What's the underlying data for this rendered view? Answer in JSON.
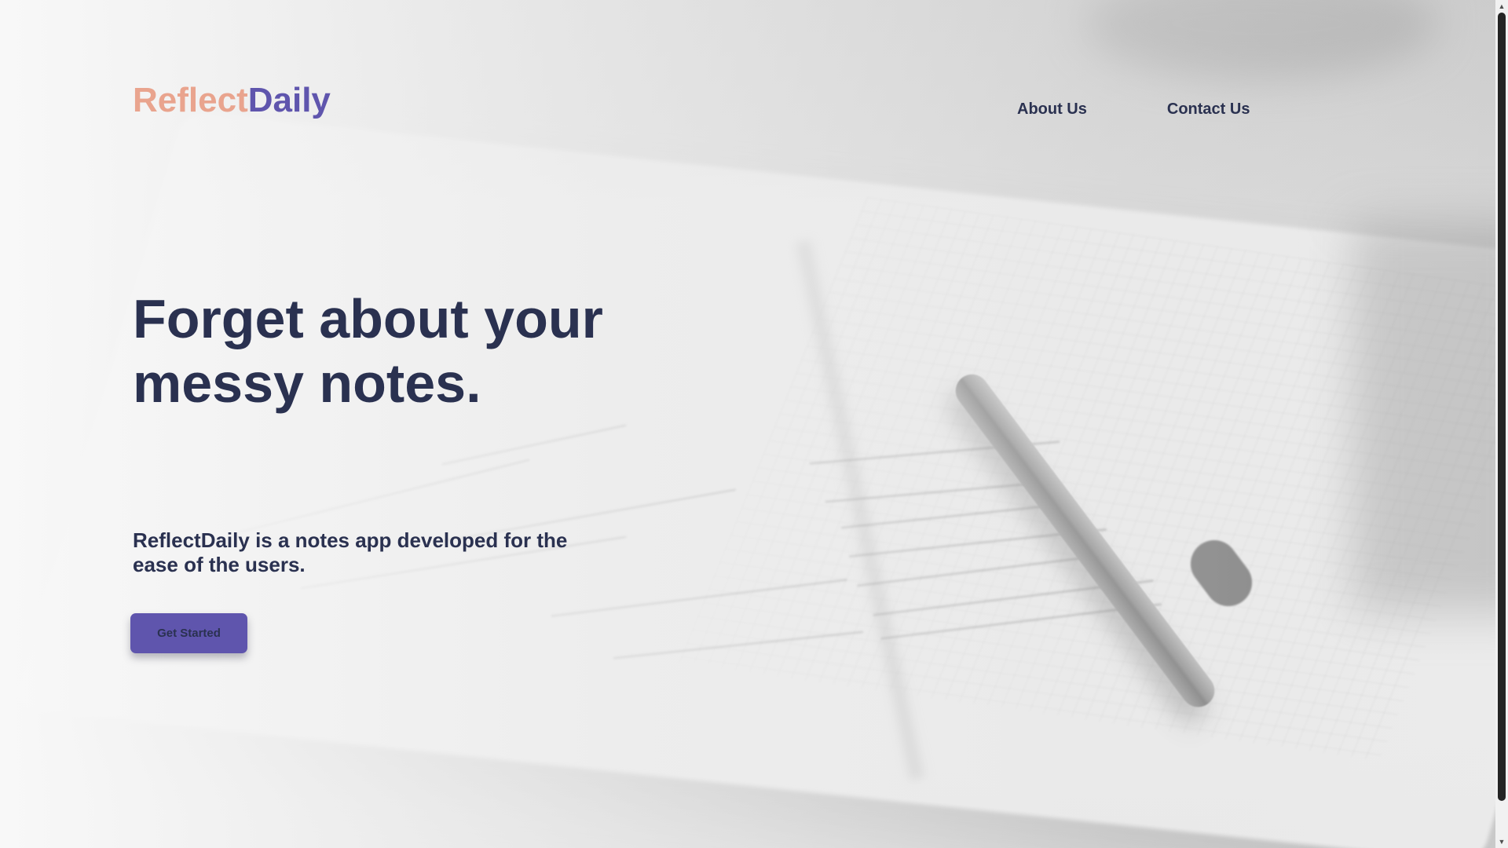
{
  "brand": {
    "part1": "Reflect",
    "part2": "Daily",
    "part1_color": "#e9a48e",
    "part2_color": "#5f55ad"
  },
  "nav": {
    "items": [
      {
        "label": "About Us"
      },
      {
        "label": "Contact Us"
      }
    ]
  },
  "hero": {
    "title": "Forget about your messy notes.",
    "subtitle": "ReflectDaily is a notes app developed for the ease of the users.",
    "cta_label": "Get Started"
  },
  "colors": {
    "text_dark": "#2a3150",
    "accent": "#5f55ad"
  },
  "icons": {
    "scroll_up": "triangle-up-icon",
    "scroll_down": "triangle-down-icon"
  }
}
